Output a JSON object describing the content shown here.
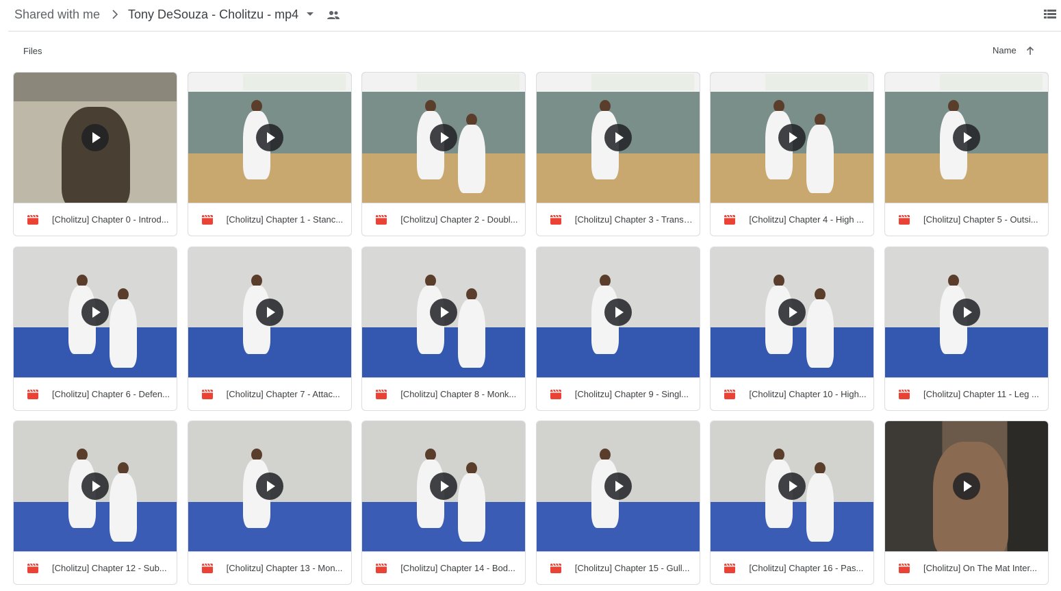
{
  "breadcrumb": {
    "root": "Shared with me",
    "current": "Tony DeSouza - Cholitzu - mp4"
  },
  "icons": {
    "separator": "chevron-right-icon",
    "folder_menu": "caret-down-icon",
    "shared": "people-icon",
    "view_toggle": "list-view-icon",
    "sort_direction": "arrow-up-icon",
    "file_type": "video-file-icon",
    "play": "play-icon"
  },
  "section": {
    "label": "Files"
  },
  "sort": {
    "label": "Name"
  },
  "colors": {
    "video_icon": "#ea4335",
    "text": "#3c4043",
    "divider": "#dadce0"
  },
  "files": [
    {
      "name": "[Cholitzu] Chapter 0 - Introd..."
    },
    {
      "name": "[Cholitzu] Chapter 1 - Stanc..."
    },
    {
      "name": "[Cholitzu] Chapter 2 - Doubl..."
    },
    {
      "name": "[Cholitzu] Chapter 3 - Transi..."
    },
    {
      "name": "[Cholitzu] Chapter 4 - High ..."
    },
    {
      "name": "[Cholitzu] Chapter 5 - Outsi..."
    },
    {
      "name": "[Cholitzu] Chapter 6 - Defen..."
    },
    {
      "name": "[Cholitzu] Chapter 7 - Attac..."
    },
    {
      "name": "[Cholitzu] Chapter 8 - Monk..."
    },
    {
      "name": "[Cholitzu] Chapter 9 - Singl..."
    },
    {
      "name": "[Cholitzu] Chapter 10 - High..."
    },
    {
      "name": "[Cholitzu] Chapter 11 - Leg ..."
    },
    {
      "name": "[Cholitzu] Chapter 12 - Sub..."
    },
    {
      "name": "[Cholitzu] Chapter 13 - Mon..."
    },
    {
      "name": "[Cholitzu] Chapter 14 - Bod..."
    },
    {
      "name": "[Cholitzu] Chapter 15 - Gull..."
    },
    {
      "name": "[Cholitzu] Chapter 16 - Pas..."
    },
    {
      "name": "[Cholitzu] On The Mat Inter..."
    }
  ]
}
